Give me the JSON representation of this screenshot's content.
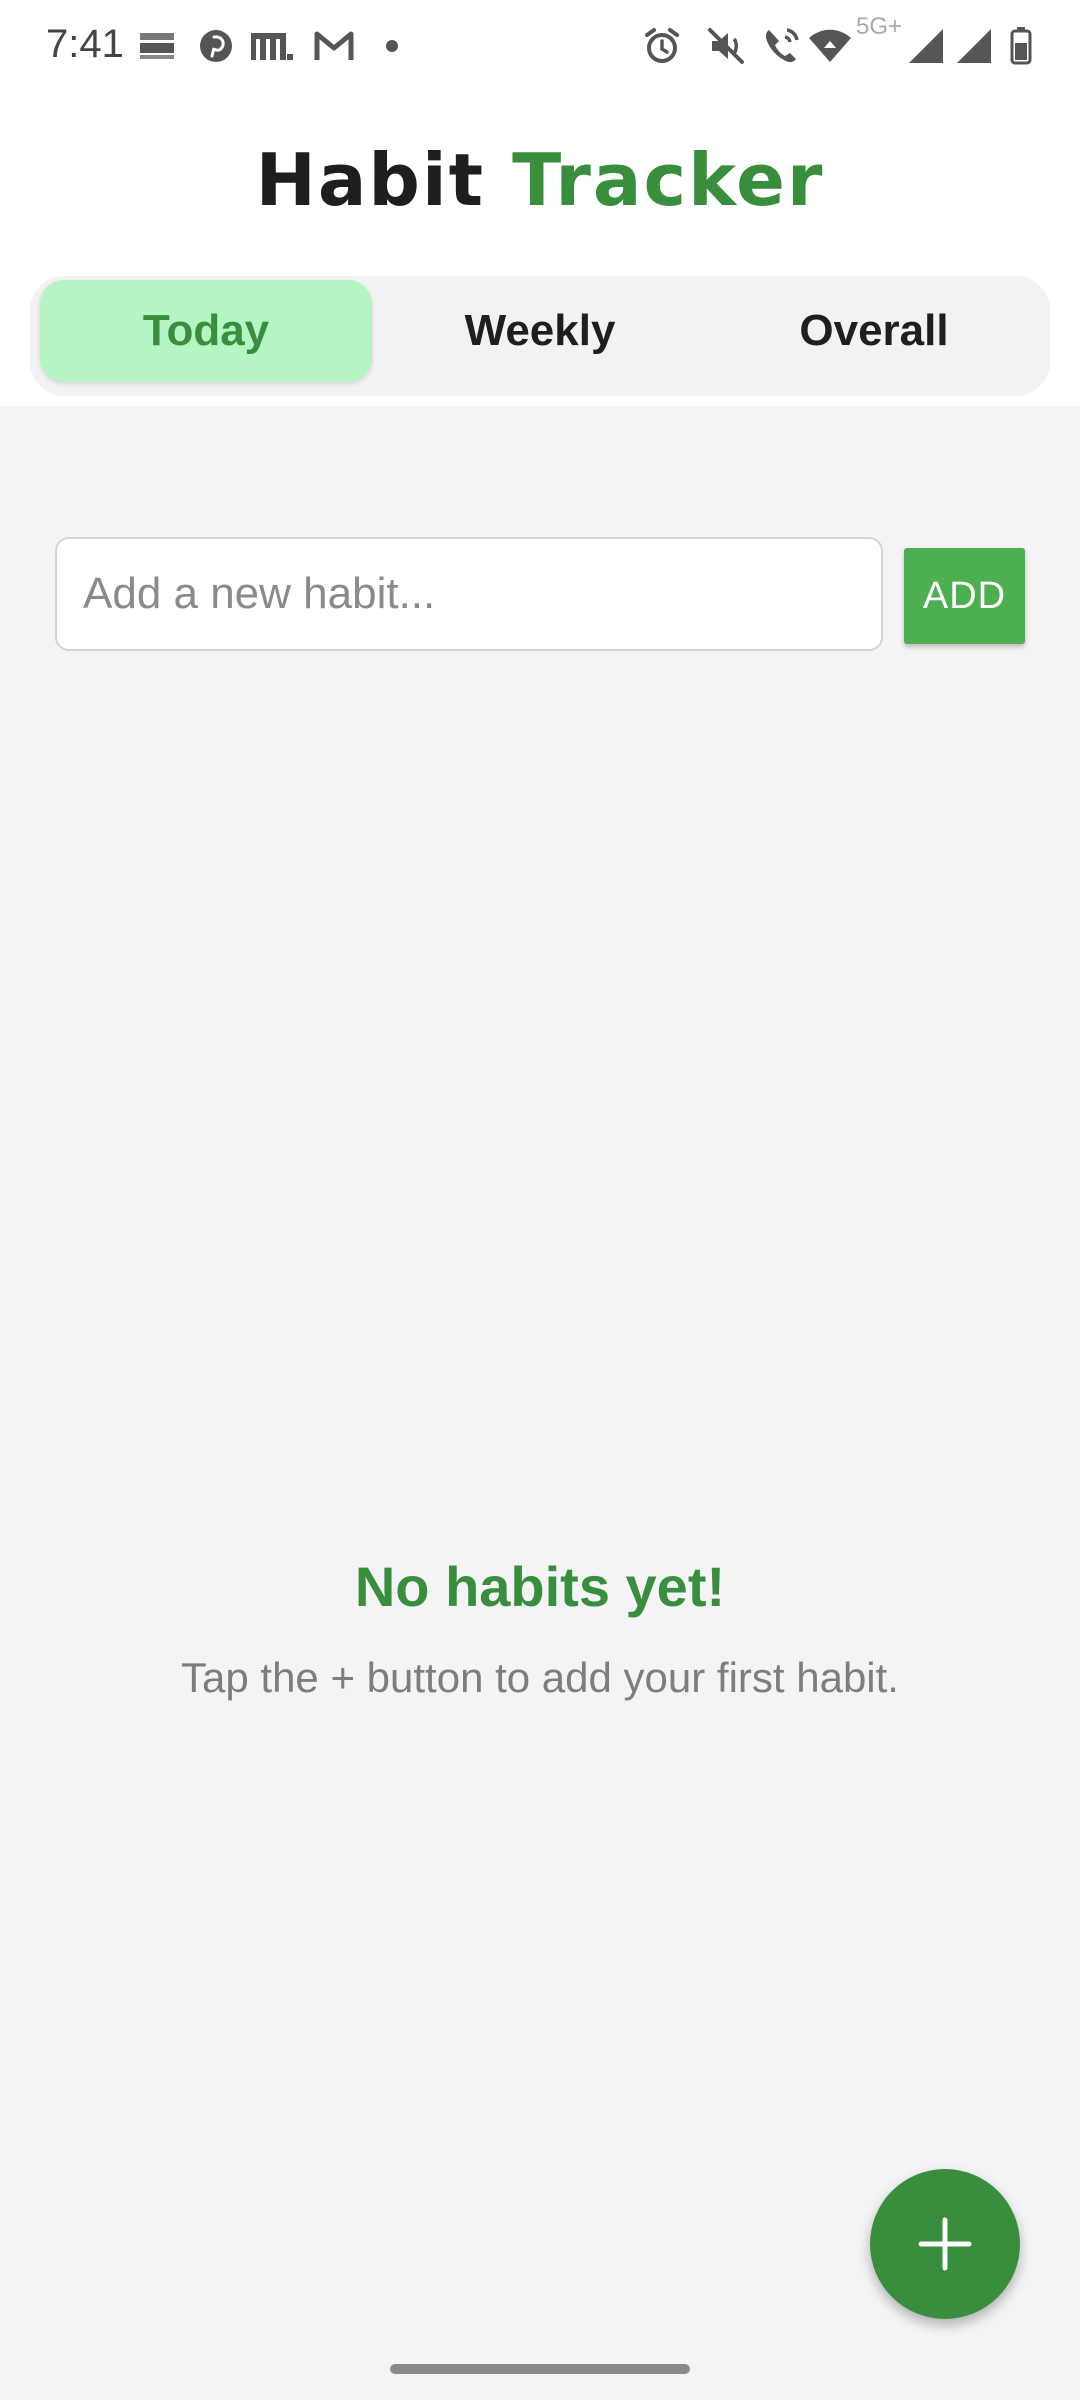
{
  "status_bar": {
    "time": "7:41",
    "network_label": "5G+",
    "icons": [
      "miracle-mind-icon",
      "pinterest-icon",
      "m-app-icon",
      "gmail-icon",
      "dot-icon",
      "alarm-icon",
      "mute-icon",
      "wifi-calling-icon",
      "wifi-icon",
      "signal-icon",
      "signal-icon",
      "battery-icon"
    ]
  },
  "header": {
    "title_part1": "Habit",
    "title_part2": "Tracker",
    "accent_color": "#388e3c"
  },
  "tabs": [
    {
      "label": "Today",
      "active": true
    },
    {
      "label": "Weekly",
      "active": false
    },
    {
      "label": "Overall",
      "active": false
    }
  ],
  "input": {
    "placeholder": "Add a new habit...",
    "value": ""
  },
  "add_button": {
    "label": "ADD",
    "color": "#4caf50"
  },
  "empty_state": {
    "title": "No habits yet!",
    "subtitle": "Tap the + button to add your first habit."
  },
  "fab": {
    "icon": "plus-icon",
    "color": "#388e3c"
  }
}
